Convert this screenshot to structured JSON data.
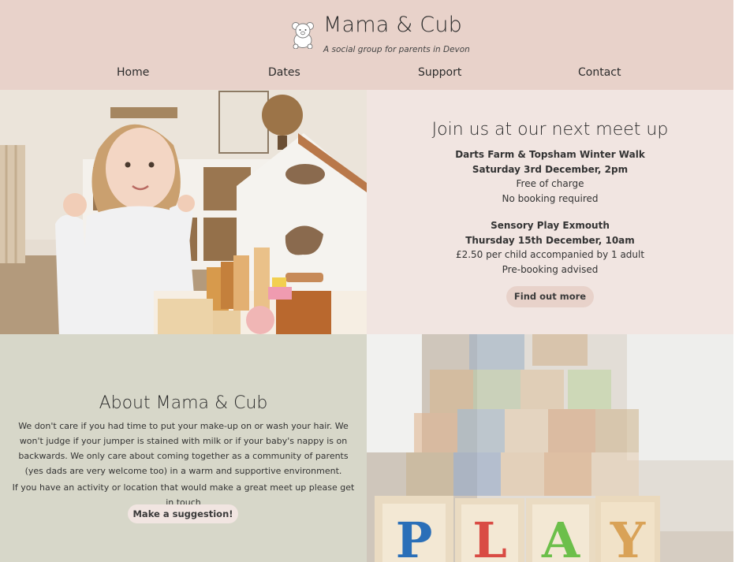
{
  "header": {
    "title": "Mama & Cub",
    "subtitle": "A social group for parents in Devon",
    "logo_icon": "teddy-bear-icon"
  },
  "nav": {
    "items": [
      {
        "label": "Home"
      },
      {
        "label": "Dates"
      },
      {
        "label": "Support"
      },
      {
        "label": "Contact"
      }
    ]
  },
  "events": {
    "heading": "Join us at our next meet up",
    "items": [
      {
        "name": "Darts Farm & Topsham Winter Walk",
        "when": "Saturday 3rd December, 2pm",
        "price": "Free of charge",
        "booking": "No booking required"
      },
      {
        "name": "Sensory Play Exmouth",
        "when": "Thursday 15th December, 10am",
        "price": "£2.50 per child accompanied by 1 adult",
        "booking": "Pre-booking advised"
      }
    ],
    "button_label": "Find out more"
  },
  "about": {
    "heading": "About Mama & Cub",
    "text_1": "We don't care if you had time to put your make-up on or wash your hair. We won't judge if your jumper is stained with milk or if your baby's nappy is on backwards. We only care about coming together as a community of parents (yes dads are very welcome too) in a warm and supportive environment.",
    "text_2": "If you have an activity or location that would make a great meet up please get in touch",
    "button_label": "Make a suggestion!"
  },
  "colors": {
    "header_bg": "#e8d2ca",
    "events_bg": "#f1e5e1",
    "about_bg": "#d7d7c9"
  }
}
